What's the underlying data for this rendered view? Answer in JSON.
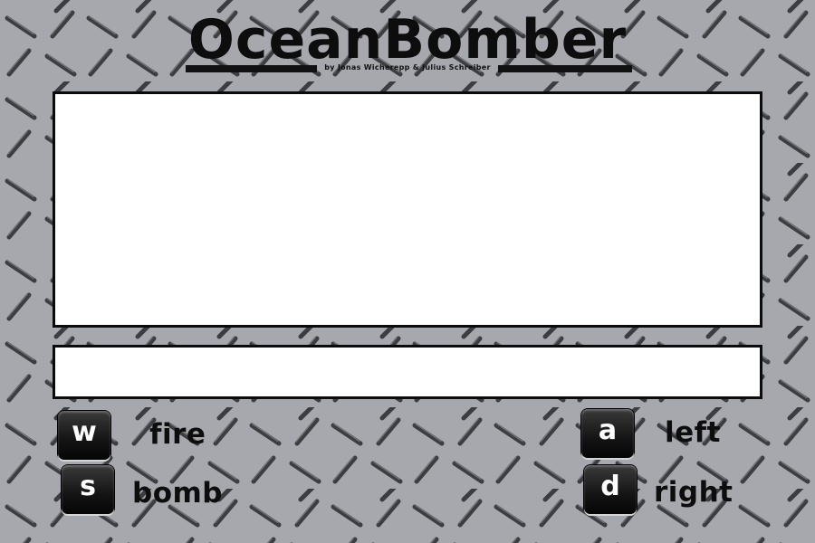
{
  "game": {
    "title": "OceanBomber",
    "credits": "by Jonas Wicherepp & Julius Schreiber"
  },
  "controls": [
    {
      "key": "w",
      "action": "fire"
    },
    {
      "key": "s",
      "action": "bomb"
    },
    {
      "key": "a",
      "action": "left"
    },
    {
      "key": "d",
      "action": "right"
    }
  ],
  "colors": {
    "background": "#a7a8ad",
    "pattern": "#3c3d40",
    "panel": "#ffffff",
    "border": "#0b0b0b",
    "key_cap": "#141414",
    "key_text": "#ffffff"
  }
}
